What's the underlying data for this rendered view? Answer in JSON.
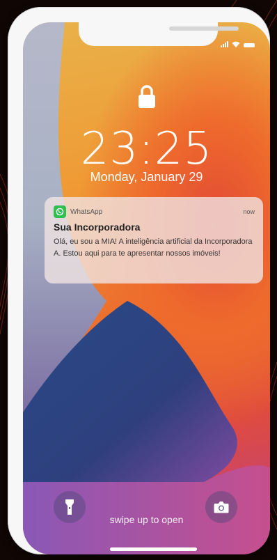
{
  "status": {
    "signal_icon": "signal-bars-icon",
    "wifi_icon": "wifi-icon",
    "battery_icon": "battery-icon"
  },
  "lockscreen": {
    "time": "23:25",
    "date": "Monday, January 29",
    "swipe_hint": "swipe up to open"
  },
  "notification": {
    "app": "WhatsApp",
    "time": "now",
    "title": "Sua Incorporadora",
    "body": "Olá, eu sou a MIA! A inteligência artificial da Incorporadora A. Estou aqui para te apresentar nossos imóveis!"
  },
  "colors": {
    "accent_whatsapp": "#2fbf4f",
    "frame": "#f7f7f7",
    "background": "#100604"
  }
}
